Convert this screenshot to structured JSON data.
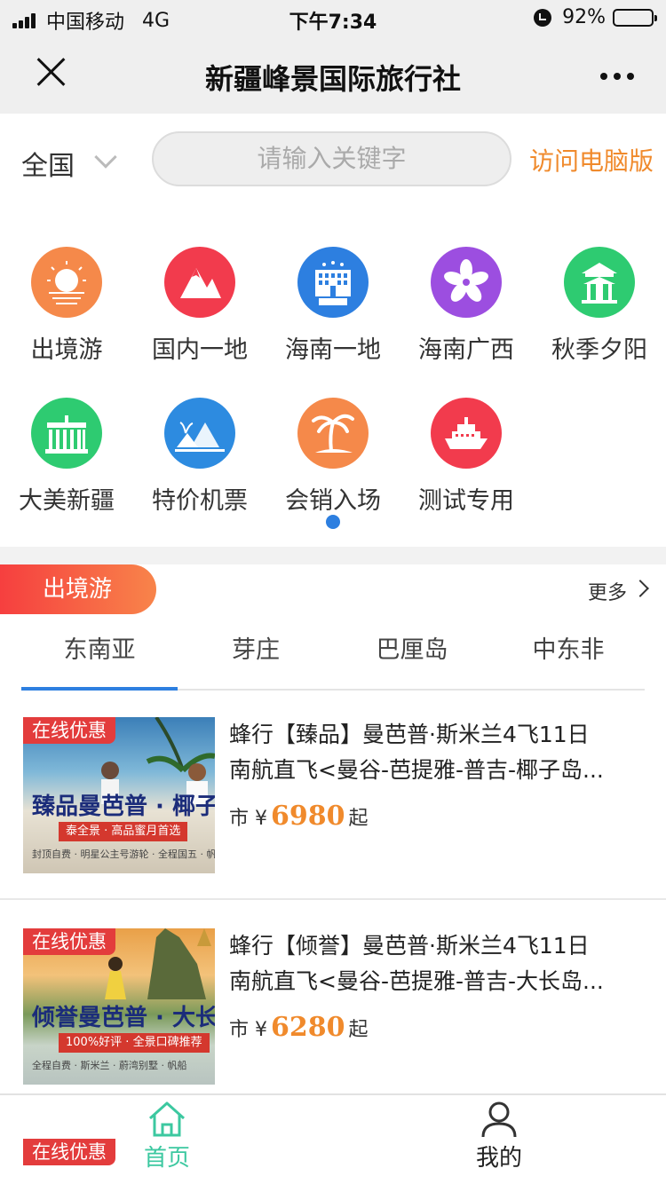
{
  "status_bar": {
    "carrier": "中国移动",
    "network": "4G",
    "time": "下午7:34",
    "battery": "92%",
    "battery_level": 0.92
  },
  "nav": {
    "title": "新疆峰景国际旅行社"
  },
  "search": {
    "region": "全国",
    "placeholder": "请输入关键字",
    "pc_link": "访问电脑版"
  },
  "categories": [
    {
      "label": "出境游",
      "icon": "sunset-icon",
      "color": "#f5894a"
    },
    {
      "label": "国内一地",
      "icon": "mountain-icon",
      "color": "#f23b4d"
    },
    {
      "label": "海南一地",
      "icon": "hotel-icon",
      "color": "#2d7fe0"
    },
    {
      "label": "海南广西",
      "icon": "flower-icon",
      "color": "#9c4ee0"
    },
    {
      "label": "秋季夕阳",
      "icon": "pavilion-icon",
      "color": "#2ecb71"
    },
    {
      "label": "大美新疆",
      "icon": "gate-icon",
      "color": "#2ecb71"
    },
    {
      "label": "特价机票",
      "icon": "island-icon",
      "color": "#2d8be0"
    },
    {
      "label": "会销入场",
      "icon": "palm-icon",
      "color": "#f5894a"
    },
    {
      "label": "测试专用",
      "icon": "cruise-ship-icon",
      "color": "#f23b4d"
    }
  ],
  "section": {
    "tag": "出境游",
    "more": "更多"
  },
  "tabs": [
    "东南亚",
    "芽庄",
    "巴厘岛",
    "中东非"
  ],
  "products": [
    {
      "promo": "在线优惠",
      "banner": "臻品曼芭普 · 椰子",
      "ribbon": "泰全景 · 高品蜜月首选",
      "fine": "封顶自费 · 明星公主号游轮 · 全程国五 · 帆",
      "title_line1": "蜂行【臻品】曼芭普·斯米兰4飞11日",
      "title_line2": "南航直飞<曼谷-芭提雅-普吉-椰子岛...",
      "price_prefix": "市 ¥",
      "price": "6980",
      "price_suffix": "起"
    },
    {
      "promo": "在线优惠",
      "banner": "倾誉曼芭普 · 大长",
      "ribbon": "100%好评 · 全景口碑推荐",
      "fine": "全程自费 · 斯米兰 · 蔚湾别墅 · 帆船",
      "title_line1": "蜂行【倾誉】曼芭普·斯米兰4飞11日",
      "title_line2": "南航直飞<曼谷-芭提雅-普吉-大长岛...",
      "price_prefix": "市 ¥",
      "price": "6280",
      "price_suffix": "起"
    }
  ],
  "float_promo": "在线优惠",
  "tabbar": {
    "home": "首页",
    "mine": "我的",
    "active_color": "#3cc8a0"
  }
}
